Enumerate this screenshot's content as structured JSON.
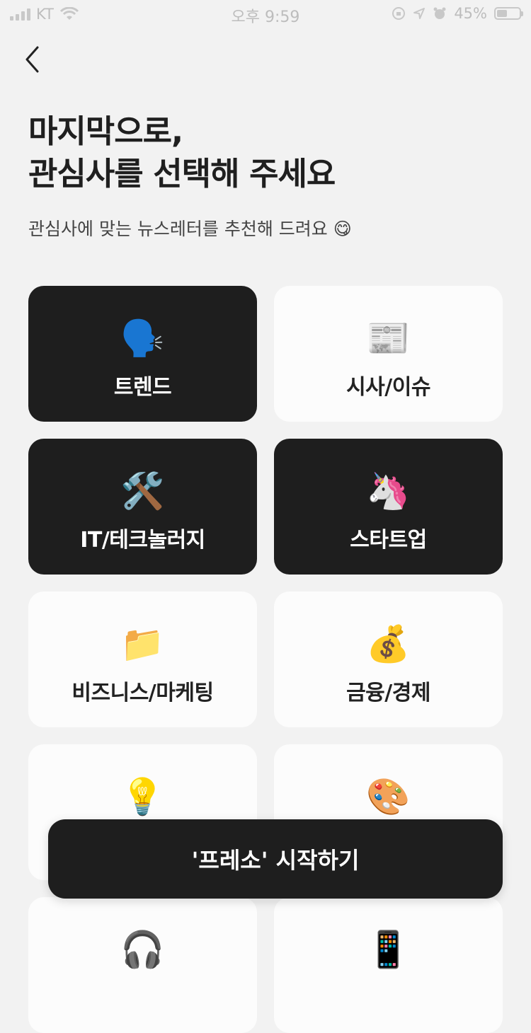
{
  "status_bar": {
    "carrier": "KT",
    "time": "오후 9:59",
    "battery": "45%",
    "battery_level": 0.45
  },
  "header": {
    "title_line1": "마지막으로,",
    "title_line2": "관심사를 선택해 주세요",
    "subtitle": "관심사에 맞는 뉴스레터를 추천해 드려요 😋"
  },
  "categories": [
    {
      "label": "트렌드",
      "emoji": "🗣️",
      "icon": "speaking-head-icon",
      "selected": true
    },
    {
      "label": "시사/이슈",
      "emoji": "📰",
      "icon": "newspaper-icon",
      "selected": false
    },
    {
      "label": "IT/테크놀러지",
      "emoji": "🛠️",
      "icon": "tools-icon",
      "selected": true
    },
    {
      "label": "스타트업",
      "emoji": "🦄",
      "icon": "unicorn-icon",
      "selected": true
    },
    {
      "label": "비즈니스/마케팅",
      "emoji": "📁",
      "icon": "folder-icon",
      "selected": false
    },
    {
      "label": "금융/경제",
      "emoji": "💰",
      "icon": "money-bag-icon",
      "selected": false
    },
    {
      "label": "",
      "emoji": "💡",
      "icon": "light-bulb-icon",
      "selected": false
    },
    {
      "label": "",
      "emoji": "🎨",
      "icon": "palette-icon",
      "selected": false
    },
    {
      "label": "",
      "emoji": "🎧",
      "icon": "headphones-icon",
      "selected": false
    },
    {
      "label": "",
      "emoji": "📱",
      "icon": "mobile-phone-icon",
      "selected": false
    }
  ],
  "start_button": {
    "label": "'프레소' 시작하기"
  },
  "colors": {
    "background": "#f2f2f2",
    "card": "#fcfcfc",
    "selected_card": "#1e1e1e",
    "button": "#1e1e1e"
  }
}
